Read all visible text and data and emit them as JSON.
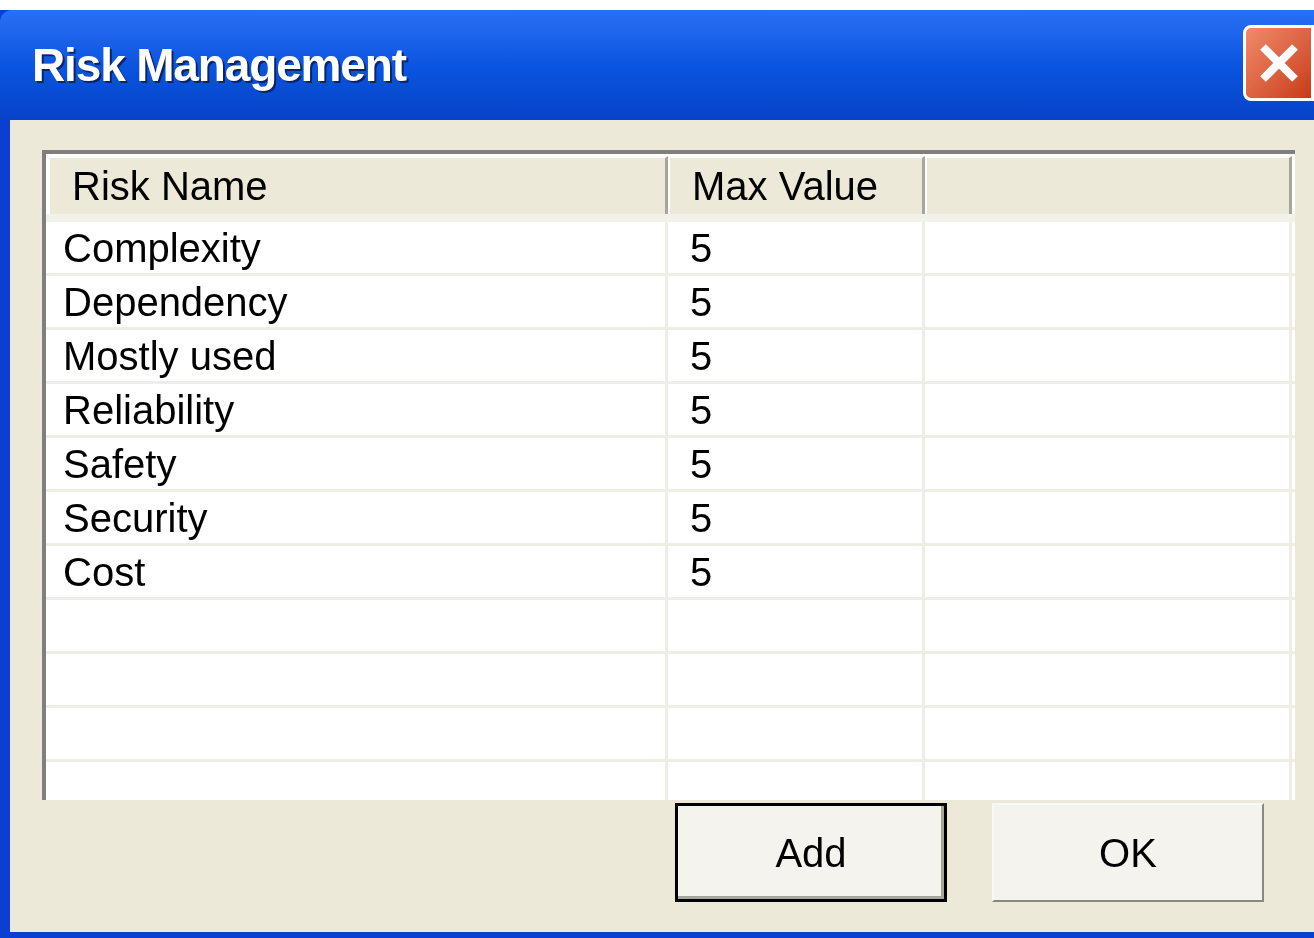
{
  "window": {
    "title": "Risk Management"
  },
  "table": {
    "columns": [
      "Risk Name",
      "Max Value"
    ],
    "rows": [
      {
        "name": "Complexity",
        "max_value": "5"
      },
      {
        "name": "Dependency",
        "max_value": "5"
      },
      {
        "name": "Mostly used",
        "max_value": "5"
      },
      {
        "name": "Reliability",
        "max_value": "5"
      },
      {
        "name": "Safety",
        "max_value": "5"
      },
      {
        "name": "Security",
        "max_value": "5"
      },
      {
        "name": "Cost",
        "max_value": "5"
      }
    ]
  },
  "buttons": [
    {
      "label": "Add",
      "default": true
    },
    {
      "label": "OK",
      "default": false
    }
  ]
}
